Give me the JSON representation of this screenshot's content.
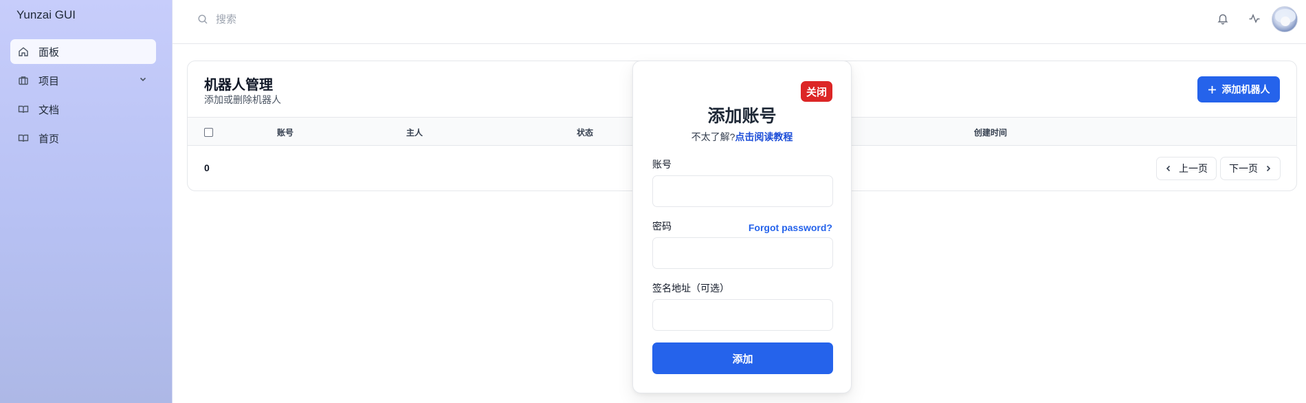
{
  "app": {
    "title": "Yunzai GUI"
  },
  "sidebar": {
    "items": [
      {
        "label": "面板",
        "icon": "home-icon",
        "active": true
      },
      {
        "label": "项目",
        "icon": "briefcase-icon",
        "has_submenu": true
      },
      {
        "label": "文档",
        "icon": "book-icon"
      },
      {
        "label": "首页",
        "icon": "book-icon"
      }
    ]
  },
  "topbar": {
    "search_placeholder": "搜索",
    "icons": [
      "bell-icon",
      "activity-icon",
      "avatar"
    ]
  },
  "card": {
    "title": "机器人管理",
    "subtitle": "添加或删除机器人",
    "add_button": "添加机器人",
    "columns": [
      "账号",
      "主人",
      "状态",
      "创建时间"
    ],
    "row_count": "0",
    "prev_label": "上一页",
    "next_label": "下一页"
  },
  "modal": {
    "close_label": "关闭",
    "title": "添加账号",
    "hint_prefix": "不太了解?",
    "hint_link": "点击阅读教程",
    "account_label": "账号",
    "password_label": "密码",
    "forgot_password": "Forgot password?",
    "sign_label": "签名地址（可选）",
    "account_value": "",
    "password_value": "",
    "sign_value": "",
    "submit_label": "添加"
  },
  "colors": {
    "primary": "#2563eb",
    "danger": "#dc2626",
    "sidebar_bg": "#bfc7f7"
  }
}
